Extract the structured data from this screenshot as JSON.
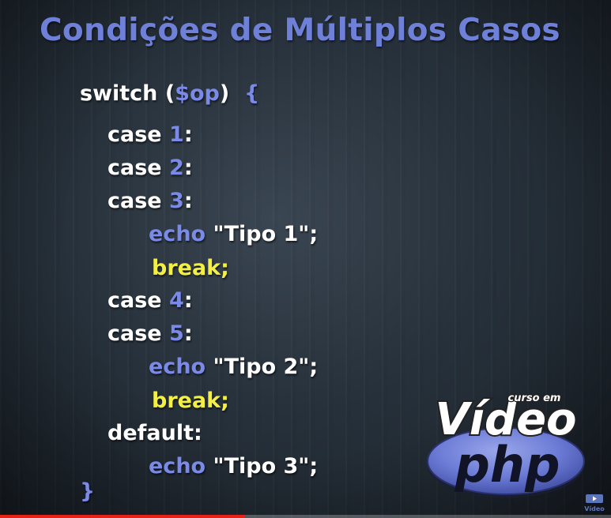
{
  "slide": {
    "title": "Condições de Múltiplos Casos"
  },
  "code": {
    "lines": [
      {
        "kw": "switch",
        "open": "(",
        "var": "$op",
        "close": ")",
        "brace": "{"
      },
      {
        "kw": "case",
        "num": "1",
        "colon": ":"
      },
      {
        "kw": "case",
        "num": "2",
        "colon": ":"
      },
      {
        "kw": "case",
        "num": "3",
        "colon": ":"
      },
      {
        "kw": "echo",
        "str": "\"Tipo 1\"",
        "semi": ";"
      },
      {
        "kw": "break;"
      },
      {
        "kw": "case",
        "num": "4",
        "colon": ":"
      },
      {
        "kw": "case",
        "num": "5",
        "colon": ":"
      },
      {
        "kw": "echo",
        "str": "\"Tipo 2\"",
        "semi": ";"
      },
      {
        "kw": "break;"
      },
      {
        "kw": "default:"
      },
      {
        "kw": "echo",
        "str": "\"Tipo 3\"",
        "semi": ";"
      },
      {
        "kw": "}"
      }
    ]
  },
  "logo": {
    "top_text": "curso em",
    "main_text": "Vídeo",
    "badge_text": "php"
  },
  "player": {
    "progress_percent": 40,
    "icon_label": "Vídeo"
  },
  "colors": {
    "title": "#6f80d8",
    "keyword": "#ffffff",
    "value": "#7a8ae6",
    "break": "#f4f043",
    "progress": "#e62117"
  }
}
